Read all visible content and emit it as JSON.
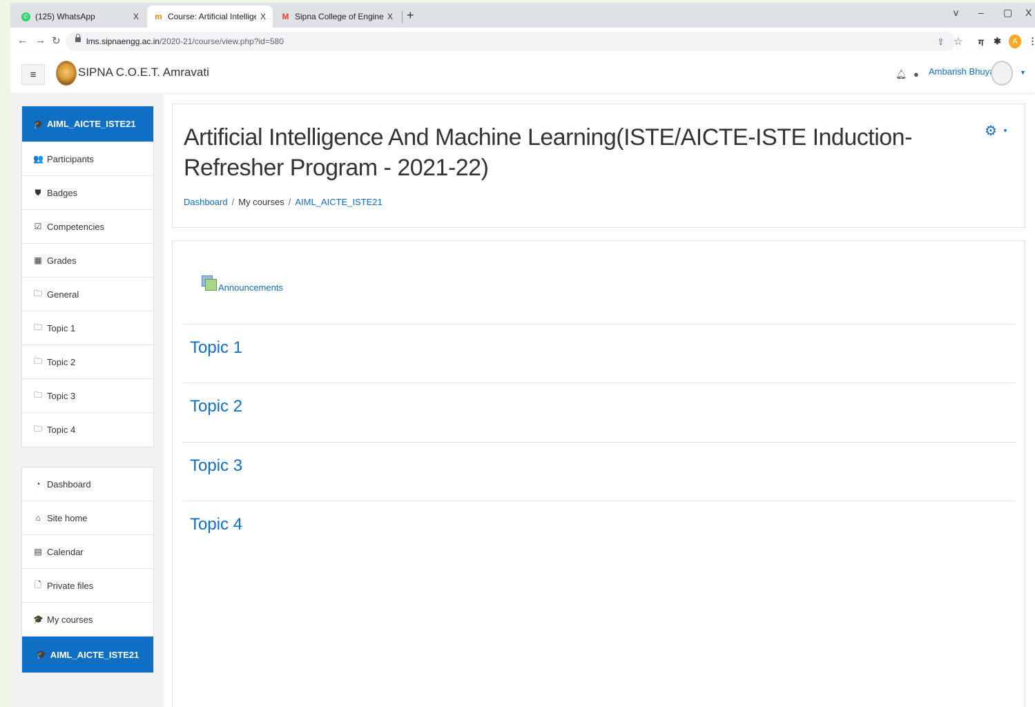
{
  "browser": {
    "tabs": [
      {
        "title": "(125) WhatsApp",
        "close": "X",
        "favicon_color": "#25d366"
      },
      {
        "title": "Course: Artificial Intelligence And",
        "close": "X",
        "favicon_color": "#f98012"
      },
      {
        "title": "Sipna College of Engineering &a",
        "close": "X",
        "favicon_color": "#ea4335"
      }
    ],
    "new_tab": "+",
    "window_controls": {
      "list": "v",
      "minimize": "–",
      "restore": "▢",
      "close": "X"
    },
    "url": {
      "host": "lms.sipnaengg.ac.in",
      "path": "/2020-21/course/view.php?id=580"
    },
    "profile_initial": "A"
  },
  "navbar": {
    "site_name": "SIPNA C.O.E.T. Amravati",
    "user_name": "Ambarish Bhuyar"
  },
  "sidebar": {
    "course_items": [
      {
        "label": "AIML_AICTE_ISTE21",
        "icon": "graduation-cap-icon",
        "glyph": "🎓"
      },
      {
        "label": "Participants",
        "icon": "users-icon",
        "glyph": "👥"
      },
      {
        "label": "Badges",
        "icon": "shield-icon",
        "glyph": "⛊"
      },
      {
        "label": "Competencies",
        "icon": "check-square-icon",
        "glyph": "☑"
      },
      {
        "label": "Grades",
        "icon": "table-icon",
        "glyph": "▦"
      },
      {
        "label": "General",
        "icon": "folder-icon",
        "glyph": "🗀"
      },
      {
        "label": "Topic 1",
        "icon": "folder-icon",
        "glyph": "🗀"
      },
      {
        "label": "Topic 2",
        "icon": "folder-icon",
        "glyph": "🗀"
      },
      {
        "label": "Topic 3",
        "icon": "folder-icon",
        "glyph": "🗀"
      },
      {
        "label": "Topic 4",
        "icon": "folder-icon",
        "glyph": "🗀"
      }
    ],
    "site_items": [
      {
        "label": "Dashboard",
        "icon": "tachometer-icon",
        "glyph": "◔"
      },
      {
        "label": "Site home",
        "icon": "home-icon",
        "glyph": "⌂"
      },
      {
        "label": "Calendar",
        "icon": "calendar-icon",
        "glyph": "▤"
      },
      {
        "label": "Private files",
        "icon": "file-icon",
        "glyph": "🗋"
      },
      {
        "label": "My courses",
        "icon": "graduation-cap-icon",
        "glyph": "🎓"
      },
      {
        "label": "AIML_AICTE_ISTE21",
        "icon": "graduation-cap-icon",
        "glyph": "🎓"
      }
    ]
  },
  "header": {
    "course_title": "Artificial Intelligence And Machine Learning(ISTE/AICTE-ISTE Induction-Refresher Program - 2021-22)",
    "breadcrumb": [
      {
        "label": "Dashboard",
        "link": true
      },
      {
        "label": "My courses",
        "link": false
      },
      {
        "label": "AIML_AICTE_ISTE21",
        "link": true
      }
    ],
    "breadcrumb_sep": "/"
  },
  "content": {
    "forum_label": "Announcements",
    "sections": [
      "Topic 1",
      "Topic 2",
      "Topic 3",
      "Topic 4"
    ]
  },
  "colors": {
    "link": "#0f6fc5",
    "active_nav": "#0f6fc5"
  }
}
